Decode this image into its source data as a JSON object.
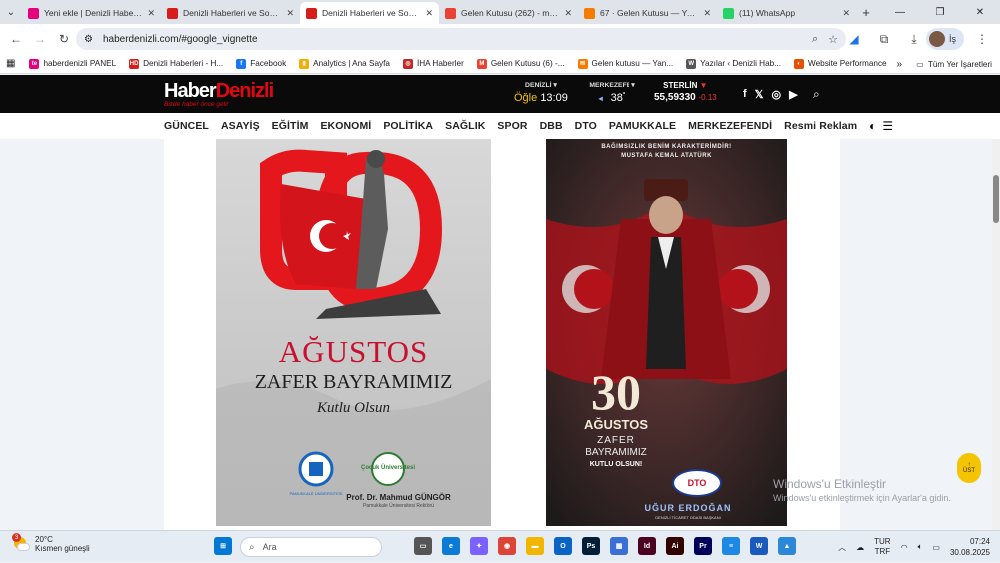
{
  "browser": {
    "tabs": [
      {
        "title": "Yeni ekle | Denizli Haberleri",
        "icon": "te-icon",
        "color": "#e6007e"
      },
      {
        "title": "Denizli Haberleri ve Son Da",
        "icon": "hd-icon",
        "color": "#d81b1b"
      },
      {
        "title": "Denizli Haberleri ve Son Da",
        "icon": "hd-icon",
        "color": "#d81b1b",
        "active": true
      },
      {
        "title": "Gelen Kutusu (262) - mutlu",
        "icon": "gmail-icon",
        "color": "#ea4335"
      },
      {
        "title": "67 · Gelen Kutusu — Yande",
        "icon": "mail-icon",
        "color": "#f57c00"
      },
      {
        "title": "(11) WhatsApp",
        "icon": "whatsapp-icon",
        "color": "#25d366"
      }
    ],
    "url": "haberdenizli.com/#google_vignette",
    "profile_initial": "İş",
    "bookmarks": [
      {
        "label": "haberdenizli PANEL",
        "icon": "te-icon",
        "color": "#e6007e",
        "text": "te"
      },
      {
        "label": "Denizli Haberleri - H...",
        "icon": "hd-icon",
        "color": "#d81b1b",
        "text": "HD"
      },
      {
        "label": "Facebook",
        "icon": "facebook-icon",
        "color": "#1877f2",
        "text": "f"
      },
      {
        "label": "Analytics | Ana Sayfa",
        "icon": "analytics-icon",
        "color": "#f9ab00",
        "text": "▮"
      },
      {
        "label": "İHA Haberler",
        "icon": "iha-icon",
        "color": "#c62828",
        "text": "◎"
      },
      {
        "label": "Gelen Kutusu (6) -...",
        "icon": "gmail-icon",
        "color": "#ea4335",
        "text": "M"
      },
      {
        "label": "Gelen kutusu — Yan...",
        "icon": "mail-icon",
        "color": "#f57c00",
        "text": "✉"
      },
      {
        "label": "Yazılar ‹ Denizli Hab...",
        "icon": "wordpress-icon",
        "color": "#555555",
        "text": "W"
      },
      {
        "label": "Website Performance",
        "icon": "performance-icon",
        "color": "#e65100",
        "text": "◐"
      }
    ],
    "all_bookmarks": "Tüm Yer İşaretleri"
  },
  "site": {
    "logo_main_a": "Haber",
    "logo_main_b": "Denizli",
    "logo_slogan": "Bizde haber önce gelir",
    "prayer_label": "DENİZLİ",
    "prayer_name": "Öğle",
    "prayer_time": "13:09",
    "weather_label": "MERKEZEFENDİ",
    "weather_temp": "38",
    "weather_unit": "°",
    "currency_label": "STERLİN",
    "currency_value": "55,59330",
    "currency_change": "-0.13",
    "categories": [
      "GÜNCEL",
      "ASAYİŞ",
      "EĞİTİM",
      "EKONOMİ",
      "POLİTİKA",
      "SAĞLIK",
      "SPOR",
      "DBB",
      "DTO",
      "PAMUKKALE",
      "MERKEZEFENDİ",
      "Resmi Reklam"
    ]
  },
  "posters": {
    "left": {
      "number": "30",
      "month": "AĞUSTOS",
      "line2": "ZAFER BAYRAMIMIZ",
      "line3": "Kutlu Olsun",
      "logo1": "PAMUKKALE ÜNİVERSİTESİ",
      "logo2": "Çocuk Üniversitesi",
      "name": "Prof. Dr. Mahmud GÜNGÖR",
      "title": "Pamukkale Üniversitesi Rektörü"
    },
    "right": {
      "quote1": "BAĞIMSIZLIK BENİM KARAKTERİMDİR!",
      "quote2": "MUSTAFA KEMAL ATATÜRK",
      "number": "30",
      "month": "AĞUSTOS",
      "line2": "ZAFER",
      "line3": "BAYRAMIMIZ",
      "line4": "KUTLU OLSUN!",
      "name": "UĞUR ERDOĞAN",
      "title": "DENİZLİ TİCARET ODASI BAŞKANI",
      "logo": "DTO"
    }
  },
  "scroll_top": "ÜST",
  "windows_watermark": {
    "line1": "Windows'u Etkinleştir",
    "line2": "Windows'u etkinleştirmek için Ayarlar'a gidin."
  },
  "taskbar": {
    "weather_badge": "3",
    "temp": "20°C",
    "condition": "Kısmen güneşli",
    "search": "Ara",
    "lang1": "TUR",
    "lang2": "TRF",
    "time": "07:24",
    "date": "30.08.2025",
    "apps": [
      {
        "name": "windows-start-icon",
        "color": "#0078d4",
        "text": "⊞"
      },
      {
        "name": "task-view-icon",
        "color": "#555555",
        "text": "▭"
      },
      {
        "name": "edge-icon",
        "color": "#0c7bd6",
        "text": "e"
      },
      {
        "name": "copilot-icon",
        "color": "#7b61ff",
        "text": "✦"
      },
      {
        "name": "chrome-icon",
        "color": "#db4437",
        "text": "◉"
      },
      {
        "name": "file-explorer-icon",
        "color": "#f2b600",
        "text": "▬"
      },
      {
        "name": "outlook-icon",
        "color": "#0a64c5",
        "text": "O"
      },
      {
        "name": "photoshop-icon",
        "color": "#001e36",
        "text": "Ps"
      },
      {
        "name": "store-icon",
        "color": "#3a6fd8",
        "text": "▦"
      },
      {
        "name": "indesign-icon",
        "color": "#49021f",
        "text": "Id"
      },
      {
        "name": "illustrator-icon",
        "color": "#330000",
        "text": "Ai"
      },
      {
        "name": "premiere-icon",
        "color": "#00005b",
        "text": "Pr"
      },
      {
        "name": "notepad-icon",
        "color": "#1e88e5",
        "text": "≡"
      },
      {
        "name": "word-icon",
        "color": "#185abd",
        "text": "W"
      },
      {
        "name": "photos-icon",
        "color": "#2b88d8",
        "text": "▲"
      }
    ]
  }
}
